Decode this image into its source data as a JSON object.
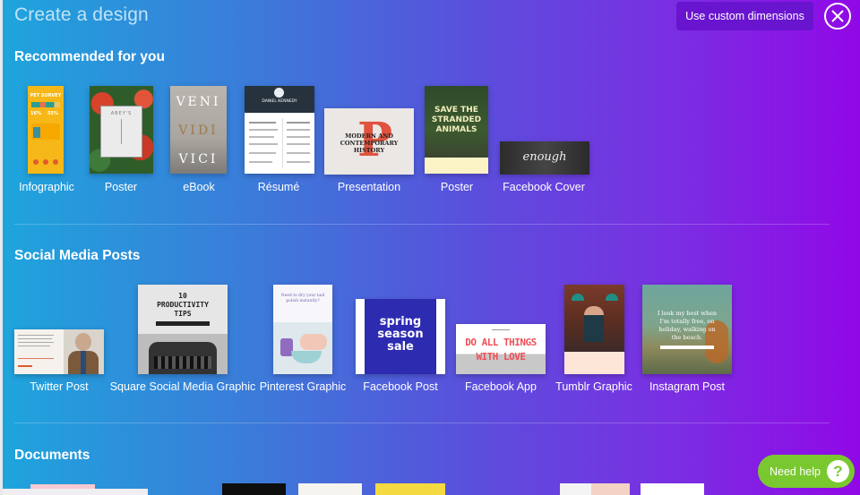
{
  "header": {
    "title": "Create a design",
    "custom_dimensions_label": "Use custom dimensions",
    "close_icon": "close-circle-icon"
  },
  "sections": [
    {
      "title": "Recommended for you",
      "items": [
        {
          "label": "Infographic",
          "thumb_text": "PET SURVEY",
          "stats": [
            "16%",
            "55%"
          ]
        },
        {
          "label": "Poster",
          "thumb_text": "ABEY'S"
        },
        {
          "label": "eBook",
          "thumb_text": [
            "VENI",
            "VIDI",
            "VICI"
          ]
        },
        {
          "label": "Résumé",
          "thumb_text": "DANIEL KENNEDY"
        },
        {
          "label": "Presentation",
          "thumb_text": [
            "MODERN AND",
            "CONTEMPORARY",
            "HISTORY"
          ]
        },
        {
          "label": "Poster",
          "thumb_text": [
            "SAVE THE",
            "STRANDED",
            "ANIMALS"
          ]
        },
        {
          "label": "Facebook Cover",
          "thumb_text": "enough"
        }
      ]
    },
    {
      "title": "Social Media Posts",
      "items": [
        {
          "label": "Twitter Post"
        },
        {
          "label": "Square Social Media Graphic",
          "thumb_text": [
            "10",
            "PRODUCTIVITY",
            "TIPS"
          ]
        },
        {
          "label": "Pinterest Graphic",
          "thumb_text": "Need to dry your nail polish instantly?"
        },
        {
          "label": "Facebook Post",
          "thumb_text": [
            "spring",
            "season",
            "sale"
          ]
        },
        {
          "label": "Facebook App",
          "thumb_text": [
            "DO ALL THINGS",
            "WITH LOVE"
          ]
        },
        {
          "label": "Tumblr Graphic"
        },
        {
          "label": "Instagram Post",
          "thumb_text": [
            "I look my best when",
            "I'm totally free, on",
            "holiday, walking on",
            "the beach."
          ]
        }
      ]
    },
    {
      "title": "Documents",
      "items": []
    }
  ],
  "help": {
    "label": "Need help",
    "icon": "?"
  },
  "colors": {
    "gradient_start": "#1ea5dc",
    "gradient_end": "#9108e6",
    "custom_button_bg": "#6914cf",
    "help_button_bg": "#7ac830"
  }
}
